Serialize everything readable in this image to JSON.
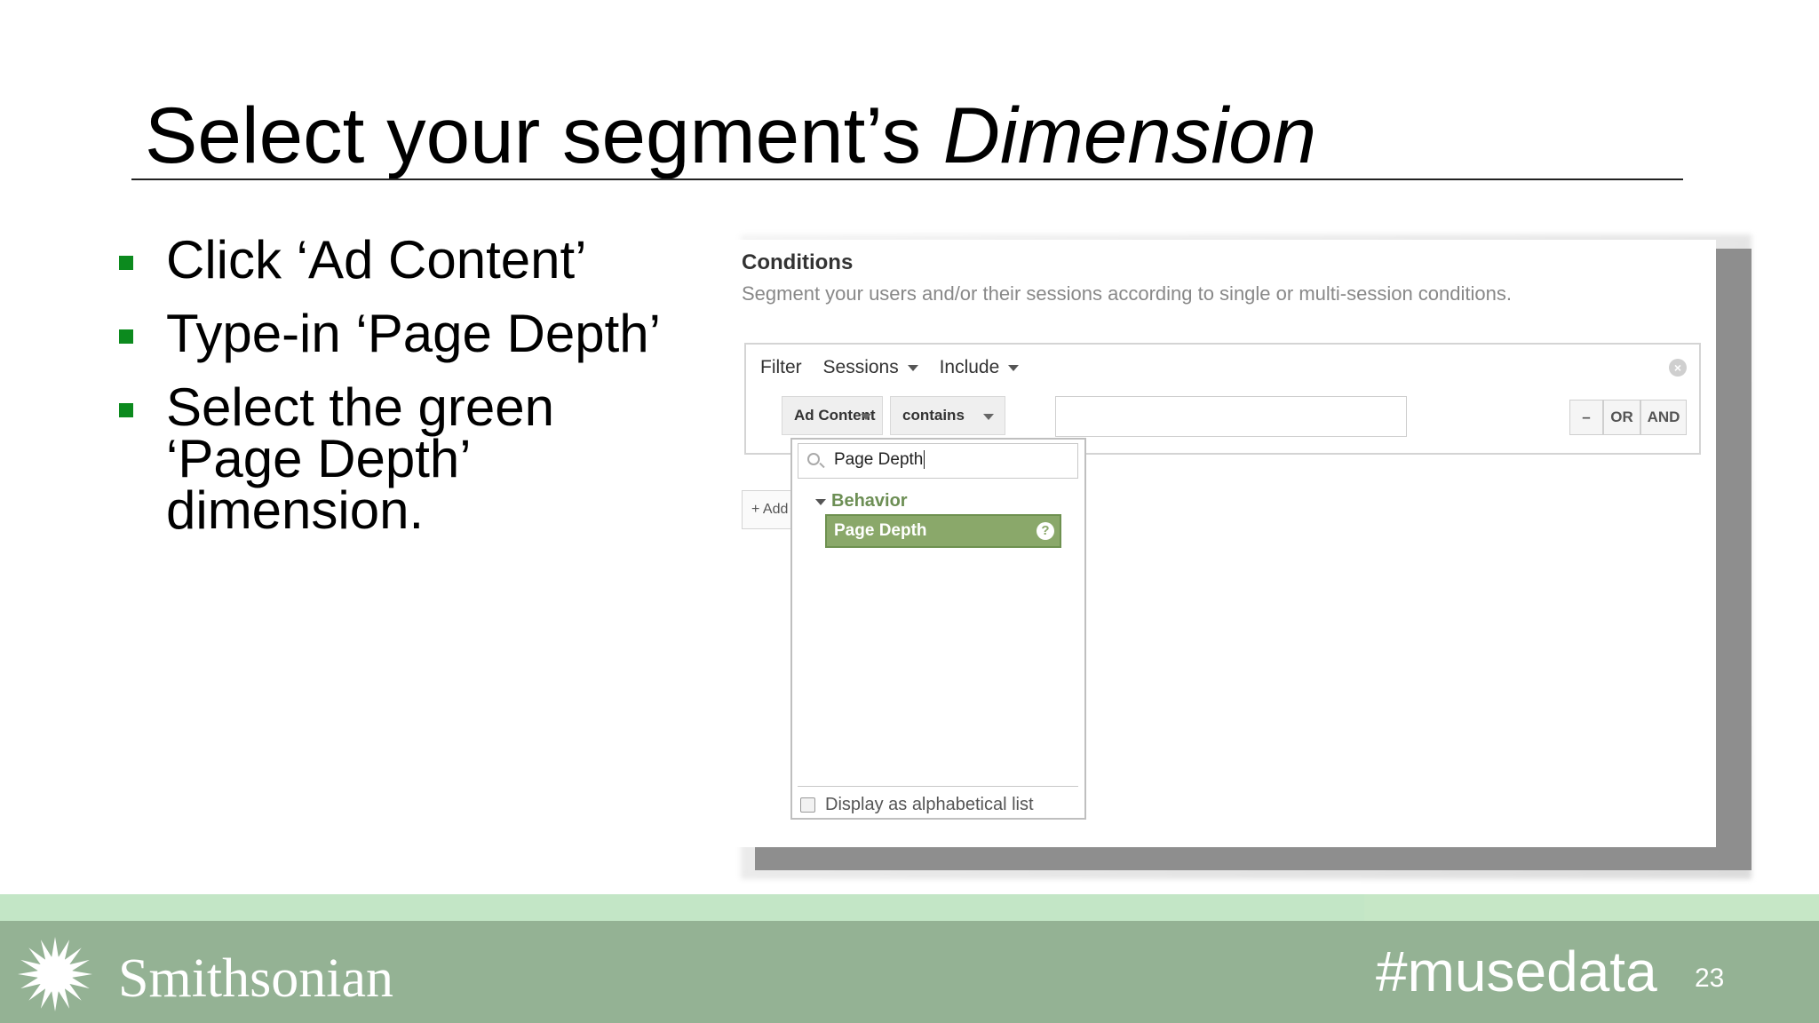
{
  "slide": {
    "title_plain": "Select your segment’s ",
    "title_italic": "Dimension",
    "bullets": [
      "Click ‘Ad Content’",
      "Type-in ‘Page Depth’",
      "Select the green ‘Page Depth’ dimension."
    ],
    "bullet_color": "#0c8a1e"
  },
  "screenshot": {
    "conditions_title": "Conditions",
    "conditions_subtitle": "Segment your users and/or their sessions according to single or multi-session conditions.",
    "filter_label": "Filter",
    "filter_scope": "Sessions",
    "filter_mode": "Include",
    "dimension_select": "Ad Content",
    "operator_select": "contains",
    "value_input": "",
    "buttons": {
      "minus": "–",
      "or": "OR",
      "and": "AND"
    },
    "add_button": "+ Add",
    "picker": {
      "search_value": "Page Depth",
      "group_label": "Behavior",
      "selected_item": "Page Depth",
      "selected_color": "#8aa86a",
      "help_icon": "?",
      "alphabetical_label": "Display as alphabetical list",
      "alphabetical_checked": false
    }
  },
  "footer": {
    "logo_text": "Smithsonian",
    "hashtag": "#musedata",
    "page_number": "23",
    "footer_color": "#94b294",
    "band_color": "#c3e6c6"
  }
}
